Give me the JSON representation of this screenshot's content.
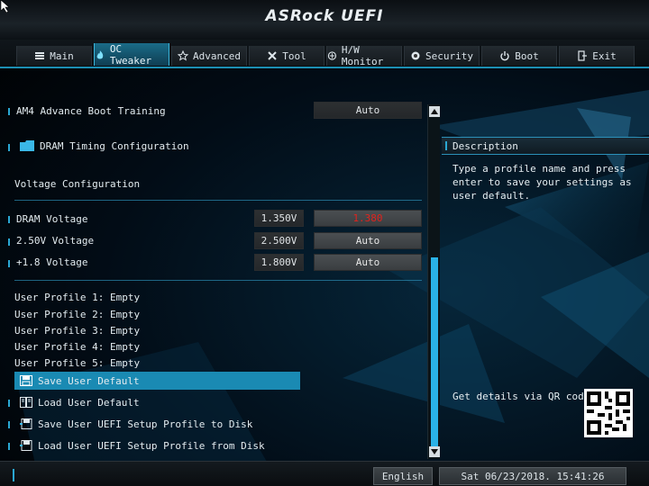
{
  "header": {
    "logo": "ASRock UEFI"
  },
  "tabs": [
    {
      "label": "Main",
      "icon": "menu-icon"
    },
    {
      "label": "OC Tweaker",
      "icon": "flame-icon",
      "active": true
    },
    {
      "label": "Advanced",
      "icon": "star-icon"
    },
    {
      "label": "Tool",
      "icon": "tools-icon"
    },
    {
      "label": "H/W Monitor",
      "icon": "monitor-icon"
    },
    {
      "label": "Security",
      "icon": "shield-icon"
    },
    {
      "label": "Boot",
      "icon": "power-icon"
    },
    {
      "label": "Exit",
      "icon": "exit-icon"
    }
  ],
  "main": {
    "boot_training": {
      "label": "AM4 Advance Boot Training",
      "value": "Auto"
    },
    "dram_timing": {
      "label": "DRAM Timing Configuration"
    },
    "voltage_header": "Voltage Configuration",
    "voltages": [
      {
        "label": "DRAM Voltage",
        "current": "1.350V",
        "setting": "1.380"
      },
      {
        "label": "2.50V Voltage",
        "current": "2.500V",
        "setting": "Auto"
      },
      {
        "label": "+1.8 Voltage",
        "current": "1.800V",
        "setting": "Auto"
      }
    ],
    "profiles": [
      "User Profile 1: Empty",
      "User Profile 2: Empty",
      "User Profile 3: Empty",
      "User Profile 4: Empty",
      "User Profile 5: Empty"
    ],
    "actions": [
      {
        "label": "Save User Default",
        "icon": "save-icon",
        "selected": true
      },
      {
        "label": "Load User Default",
        "icon": "book-icon"
      },
      {
        "label": "Save User UEFI Setup Profile to Disk",
        "icon": "disk-save-icon"
      },
      {
        "label": "Load User UEFI Setup Profile from Disk",
        "icon": "disk-load-icon"
      }
    ]
  },
  "description": {
    "title": "Description",
    "lines": [
      "Type a profile name and press",
      "enter to save your settings as",
      "user default."
    ],
    "qr_label": "Get details via QR code"
  },
  "footer": {
    "language": "English",
    "datetime": "Sat 06/23/2018. 15:41:26"
  },
  "colors": {
    "accent": "#1a8ab3",
    "highlight_red": "#e0231d"
  }
}
